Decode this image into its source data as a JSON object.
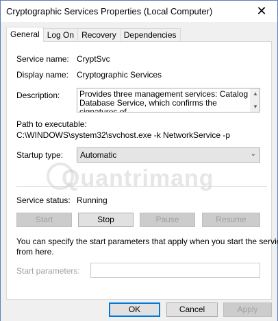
{
  "window": {
    "title": "Cryptographic Services Properties (Local Computer)"
  },
  "tabs": [
    {
      "label": "General",
      "active": true
    },
    {
      "label": "Log On",
      "active": false
    },
    {
      "label": "Recovery",
      "active": false
    },
    {
      "label": "Dependencies",
      "active": false
    }
  ],
  "general": {
    "service_name_label": "Service name:",
    "service_name_value": "CryptSvc",
    "display_name_label": "Display name:",
    "display_name_value": "Cryptographic Services",
    "description_label": "Description:",
    "description_line1": "Provides three management services: Catalog",
    "description_line2": "Database Service, which confirms the signatures of",
    "path_label": "Path to executable:",
    "path_value": "C:\\WINDOWS\\system32\\svchost.exe -k NetworkService -p",
    "startup_type_label": "Startup type:",
    "startup_type_value": "Automatic",
    "service_status_label": "Service status:",
    "service_status_value": "Running",
    "start_label": "Start",
    "stop_label": "Stop",
    "pause_label": "Pause",
    "resume_label": "Resume",
    "info_line1": "You can specify the start parameters that apply when you start the service",
    "info_line2": "from here.",
    "start_params_label": "Start parameters:",
    "start_params_value": ""
  },
  "watermark": "Quantrimang",
  "footer": {
    "ok": "OK",
    "cancel": "Cancel",
    "apply": "Apply"
  },
  "colors": {
    "accent": "#0078d7",
    "disabled_text": "#a0a0a0",
    "panel_bg": "#ffffff",
    "dialog_bg": "#f0f0f0"
  }
}
